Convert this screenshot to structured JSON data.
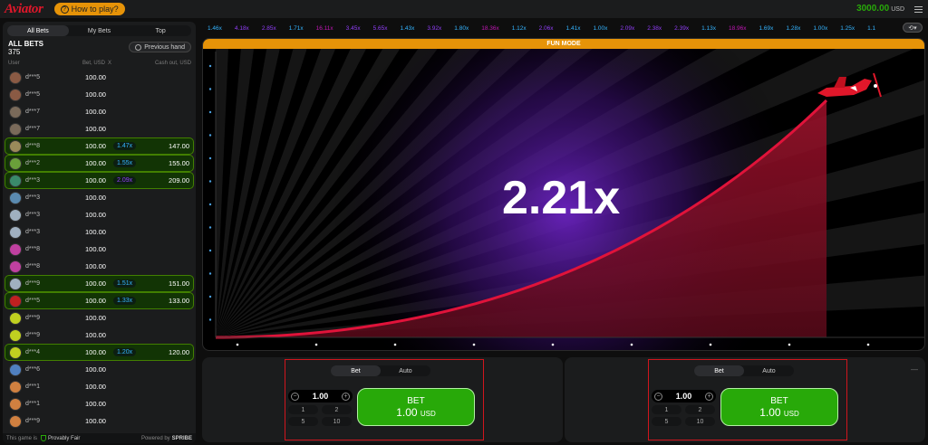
{
  "header": {
    "logo": "Aviator",
    "how_to_play": "How to play?",
    "balance": "3000.00",
    "currency": "USD"
  },
  "left_panel": {
    "tabs": [
      "All Bets",
      "My Bets",
      "Top"
    ],
    "title": "ALL BETS",
    "count": "375",
    "previous_hand": "Previous hand",
    "columns": {
      "user": "User",
      "bet": "Bet, USD",
      "x": "X",
      "cashout": "Cash out, USD"
    },
    "rows": [
      {
        "name": "d***5",
        "bet": "100.00",
        "mult": "",
        "cash": "",
        "win": false,
        "avatar": "#8a5a44"
      },
      {
        "name": "d***5",
        "bet": "100.00",
        "mult": "",
        "cash": "",
        "win": false,
        "avatar": "#8a5a44"
      },
      {
        "name": "d***7",
        "bet": "100.00",
        "mult": "",
        "cash": "",
        "win": false,
        "avatar": "#7a6a5a"
      },
      {
        "name": "d***7",
        "bet": "100.00",
        "mult": "",
        "cash": "",
        "win": false,
        "avatar": "#7a6a5a"
      },
      {
        "name": "d***8",
        "bet": "100.00",
        "mult": "1.47x",
        "cash": "147.00",
        "win": true,
        "mcolor": "blue",
        "avatar": "#9a8a5a"
      },
      {
        "name": "d***2",
        "bet": "100.00",
        "mult": "1.55x",
        "cash": "155.00",
        "win": true,
        "mcolor": "blue",
        "avatar": "#6aa03a"
      },
      {
        "name": "d***3",
        "bet": "100.00",
        "mult": "2.09x",
        "cash": "209.00",
        "win": true,
        "mcolor": "purple",
        "avatar": "#3a8a6a"
      },
      {
        "name": "d***3",
        "bet": "100.00",
        "mult": "",
        "cash": "",
        "win": false,
        "avatar": "#5a8ab0"
      },
      {
        "name": "d***3",
        "bet": "100.00",
        "mult": "",
        "cash": "",
        "win": false,
        "avatar": "#a0b0c0"
      },
      {
        "name": "d***3",
        "bet": "100.00",
        "mult": "",
        "cash": "",
        "win": false,
        "avatar": "#a0b0c0"
      },
      {
        "name": "d***8",
        "bet": "100.00",
        "mult": "",
        "cash": "",
        "win": false,
        "avatar": "#c040a0"
      },
      {
        "name": "d***8",
        "bet": "100.00",
        "mult": "",
        "cash": "",
        "win": false,
        "avatar": "#c040a0"
      },
      {
        "name": "d***9",
        "bet": "100.00",
        "mult": "1.51x",
        "cash": "151.00",
        "win": true,
        "mcolor": "blue",
        "avatar": "#a0b0c0"
      },
      {
        "name": "d***5",
        "bet": "100.00",
        "mult": "1.33x",
        "cash": "133.00",
        "win": true,
        "mcolor": "blue",
        "avatar": "#c02020"
      },
      {
        "name": "d***9",
        "bet": "100.00",
        "mult": "",
        "cash": "",
        "win": false,
        "avatar": "#c0d020"
      },
      {
        "name": "d***9",
        "bet": "100.00",
        "mult": "",
        "cash": "",
        "win": false,
        "avatar": "#c0d020"
      },
      {
        "name": "d***4",
        "bet": "100.00",
        "mult": "1.20x",
        "cash": "120.00",
        "win": true,
        "mcolor": "blue",
        "avatar": "#c0d020"
      },
      {
        "name": "d***6",
        "bet": "100.00",
        "mult": "",
        "cash": "",
        "win": false,
        "avatar": "#5080c0"
      },
      {
        "name": "d***1",
        "bet": "100.00",
        "mult": "",
        "cash": "",
        "win": false,
        "avatar": "#d08040"
      },
      {
        "name": "d***1",
        "bet": "100.00",
        "mult": "",
        "cash": "",
        "win": false,
        "avatar": "#d08040"
      },
      {
        "name": "d***9",
        "bet": "100.00",
        "mult": "",
        "cash": "",
        "win": false,
        "avatar": "#d08040"
      }
    ],
    "footer": {
      "text": "This game is",
      "provably_fair": "Provably Fair",
      "powered": "Powered by",
      "brand": "SPRIBE"
    }
  },
  "history": [
    {
      "v": "1.46x",
      "c": "blue"
    },
    {
      "v": "4.18x",
      "c": "purple"
    },
    {
      "v": "2.85x",
      "c": "purple"
    },
    {
      "v": "1.71x",
      "c": "blue"
    },
    {
      "v": "16.11x",
      "c": "pink"
    },
    {
      "v": "3.45x",
      "c": "purple"
    },
    {
      "v": "5.65x",
      "c": "purple"
    },
    {
      "v": "1.43x",
      "c": "blue"
    },
    {
      "v": "3.92x",
      "c": "purple"
    },
    {
      "v": "1.80x",
      "c": "blue"
    },
    {
      "v": "18.36x",
      "c": "pink"
    },
    {
      "v": "1.12x",
      "c": "blue"
    },
    {
      "v": "2.06x",
      "c": "purple"
    },
    {
      "v": "1.41x",
      "c": "blue"
    },
    {
      "v": "1.00x",
      "c": "blue"
    },
    {
      "v": "2.09x",
      "c": "purple"
    },
    {
      "v": "2.38x",
      "c": "purple"
    },
    {
      "v": "2.39x",
      "c": "purple"
    },
    {
      "v": "1.13x",
      "c": "blue"
    },
    {
      "v": "18.96x",
      "c": "pink"
    },
    {
      "v": "1.69x",
      "c": "blue"
    },
    {
      "v": "1.28x",
      "c": "blue"
    },
    {
      "v": "1.00x",
      "c": "blue"
    },
    {
      "v": "1.25x",
      "c": "blue"
    },
    {
      "v": "1.1",
      "c": "blue"
    }
  ],
  "game": {
    "mode": "FUN MODE",
    "multiplier": "2.21x",
    "colors": {
      "curve": "#e0133a",
      "fill": "#7a0d1e",
      "glow": "#5a1aa0",
      "plane": "#e0172a"
    }
  },
  "bet_panels": [
    {
      "tabs": [
        "Bet",
        "Auto"
      ],
      "stake": "1.00",
      "quick": [
        "1",
        "2",
        "5",
        "10"
      ],
      "button": "BET",
      "amount": "1.00",
      "currency": "USD"
    },
    {
      "tabs": [
        "Bet",
        "Auto"
      ],
      "stake": "1.00",
      "quick": [
        "1",
        "2",
        "5",
        "10"
      ],
      "button": "BET",
      "amount": "1.00",
      "currency": "USD",
      "more": "—"
    }
  ]
}
